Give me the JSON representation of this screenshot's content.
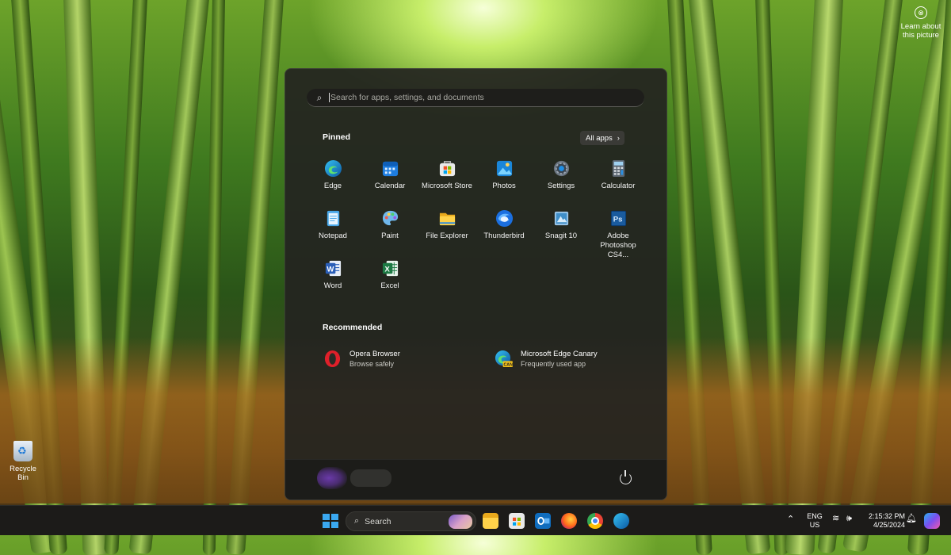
{
  "desktop": {
    "learn_label": "Learn about this picture",
    "recycle_label": "Recycle Bin"
  },
  "start_menu": {
    "search_placeholder": "Search for apps, settings, and documents",
    "pinned_title": "Pinned",
    "all_apps_label": "All apps",
    "pinned_apps": [
      {
        "label": "Edge",
        "icon": "edge-icon"
      },
      {
        "label": "Calendar",
        "icon": "calendar-icon"
      },
      {
        "label": "Microsoft Store",
        "icon": "store-icon"
      },
      {
        "label": "Photos",
        "icon": "photos-icon"
      },
      {
        "label": "Settings",
        "icon": "gear-icon"
      },
      {
        "label": "Calculator",
        "icon": "calculator-icon"
      },
      {
        "label": "Notepad",
        "icon": "notepad-icon"
      },
      {
        "label": "Paint",
        "icon": "paint-icon"
      },
      {
        "label": "File Explorer",
        "icon": "folder-icon"
      },
      {
        "label": "Thunderbird",
        "icon": "thunderbird-icon"
      },
      {
        "label": "Snagit 10",
        "icon": "snagit-icon"
      },
      {
        "label": "Adobe Photoshop CS4...",
        "icon": "photoshop-icon"
      },
      {
        "label": "Word",
        "icon": "word-icon"
      },
      {
        "label": "Excel",
        "icon": "excel-icon"
      }
    ],
    "recommended_title": "Recommended",
    "recommended": [
      {
        "title": "Opera Browser",
        "subtitle": "Browse safely",
        "icon": "opera-icon"
      },
      {
        "title": "Microsoft Edge Canary",
        "subtitle": "Frequently used app",
        "icon": "edge-canary-icon"
      }
    ]
  },
  "taskbar": {
    "search_label": "Search",
    "language": "ENG",
    "region": "US",
    "time": "2:15:32 PM",
    "date": "4/25/2024"
  },
  "colors": {
    "accent": "#3aa8f0",
    "menu_bg": "#242420",
    "taskbar_bg": "#1c1b19"
  }
}
